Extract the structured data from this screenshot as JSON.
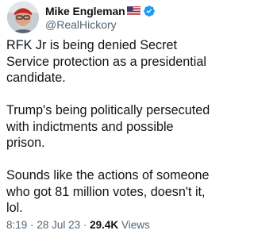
{
  "author": {
    "display_name": "Mike Engleman",
    "handle": "@RealHickory"
  },
  "icons": {
    "flag": "us-flag-emoji",
    "verified": "verified-badge-icon",
    "avatar": "profile-avatar"
  },
  "colors": {
    "verified_blue": "#1d9bf0",
    "secondary_text": "#536471",
    "primary_text": "#0f1419"
  },
  "tweet": {
    "paragraphs": [
      "RFK Jr is being denied Secret Service protection as a presidential candidate.",
      "Trump's being politically persecuted with indictments and possible prison.",
      "Sounds like the actions of someone who got 81 million votes, doesn't it, lol."
    ]
  },
  "meta": {
    "time": "8:19",
    "separator": "·",
    "date": "28 Jul 23",
    "views_count": "29.4K",
    "views_label": "Views"
  }
}
